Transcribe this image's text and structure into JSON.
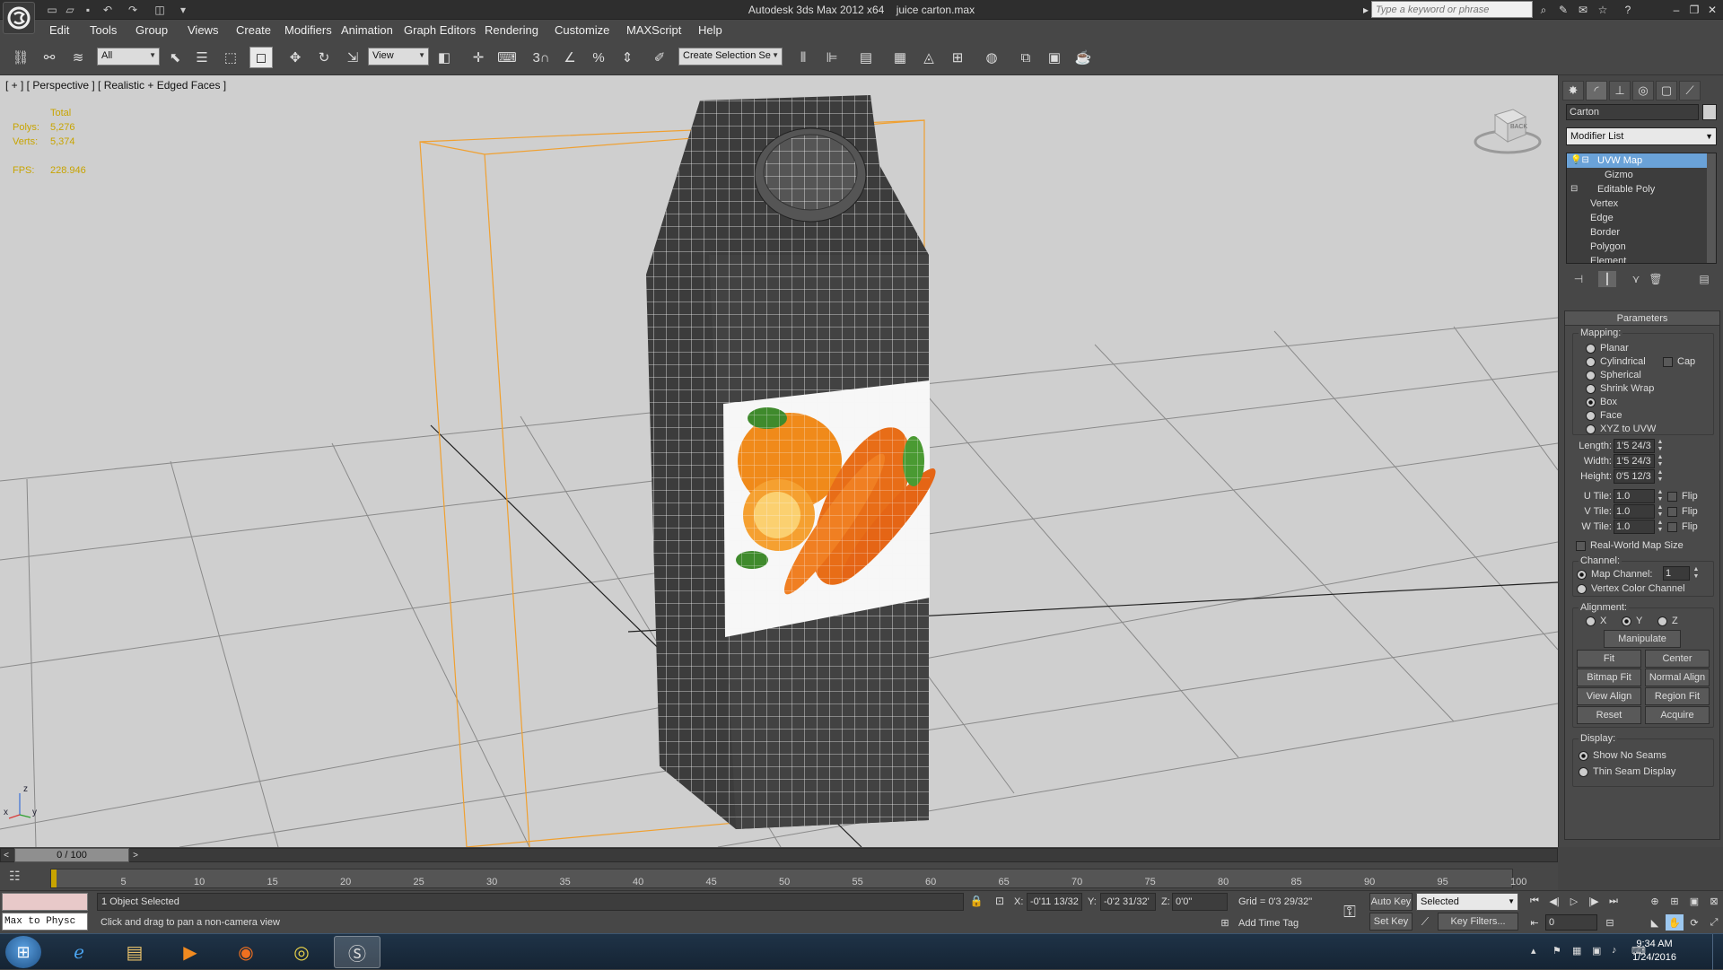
{
  "titlebar": {
    "app_title": "Autodesk 3ds Max  2012 x64",
    "file_name": "juice carton.max",
    "search_placeholder": "Type a keyword or phrase"
  },
  "menu": [
    "Edit",
    "Tools",
    "Group",
    "Views",
    "Create",
    "Modifiers",
    "Animation",
    "Graph Editors",
    "Rendering",
    "Customize",
    "MAXScript",
    "Help"
  ],
  "toolbar": {
    "selection_filter": "All",
    "ref_coord": "View",
    "named_selection": "Create Selection Se",
    "snap_label": "3"
  },
  "viewport": {
    "label": "[ + ] [ Perspective ] [ Realistic + Edged Faces ]",
    "stats": {
      "total_label": "Total",
      "polys_label": "Polys:",
      "polys_value": "5,276",
      "verts_label": "Verts:",
      "verts_value": "5,374",
      "fps_label": "FPS:",
      "fps_value": "228.946"
    },
    "viewcube_label": "BACK",
    "axis_z": "z",
    "axis_x": "x",
    "axis_y": "y"
  },
  "command_panel": {
    "object_name": "Carton",
    "modifier_list": "Modifier List",
    "stack": [
      {
        "label": "UVW Map",
        "indent": 0,
        "selected": true
      },
      {
        "label": "Gizmo",
        "indent": 2,
        "selected": false
      },
      {
        "label": "Editable Poly",
        "indent": 0,
        "selected": false
      },
      {
        "label": "Vertex",
        "indent": 1,
        "selected": false
      },
      {
        "label": "Edge",
        "indent": 1,
        "selected": false
      },
      {
        "label": "Border",
        "indent": 1,
        "selected": false
      },
      {
        "label": "Polygon",
        "indent": 1,
        "selected": false
      },
      {
        "label": "Element",
        "indent": 1,
        "selected": false
      }
    ],
    "parameters_title": "Parameters",
    "mapping_title": "Mapping:",
    "mapping_options": [
      "Planar",
      "Cylindrical",
      "Spherical",
      "Shrink Wrap",
      "Box",
      "Face",
      "XYZ to UVW"
    ],
    "mapping_selected": "Box",
    "cap_label": "Cap",
    "length_label": "Length:",
    "length_value": "1'5 24/3",
    "width_label": "Width:",
    "width_value": "1'5 24/3",
    "height_label": "Height:",
    "height_value": "0'5 12/3",
    "utile_label": "U Tile:",
    "utile_value": "1.0",
    "vtile_label": "V Tile:",
    "vtile_value": "1.0",
    "wtile_label": "W Tile:",
    "wtile_value": "1.0",
    "flip_label": "Flip",
    "real_world_label": "Real-World Map Size",
    "channel_title": "Channel:",
    "map_channel_label": "Map Channel:",
    "map_channel_value": "1",
    "vertex_color_label": "Vertex Color Channel",
    "alignment_title": "Alignment:",
    "align_x": "X",
    "align_y": "Y",
    "align_z": "Z",
    "manipulate": "Manipulate",
    "fit": "Fit",
    "center": "Center",
    "bitmap_fit": "Bitmap Fit",
    "normal_align": "Normal Align",
    "view_align": "View Align",
    "region_fit": "Region Fit",
    "reset": "Reset",
    "acquire": "Acquire",
    "display_title": "Display:",
    "show_no_seams": "Show No Seams",
    "thin_seam": "Thin Seam Display"
  },
  "timeline": {
    "slider_label": "0 / 100",
    "ticks": [
      "5",
      "10",
      "15",
      "20",
      "25",
      "30",
      "35",
      "40",
      "45",
      "50",
      "55",
      "60",
      "65",
      "70",
      "75",
      "80",
      "85",
      "90",
      "95",
      "100"
    ]
  },
  "status": {
    "maxscript_input": "Max to Physc",
    "selection": "1 Object Selected",
    "prompt": "Click and drag to pan a non-camera view",
    "x_label": "X:",
    "x_value": "-0'11 13/32",
    "y_label": "Y:",
    "y_value": "-0'2 31/32'",
    "z_label": "Z:",
    "z_value": "0'0\"",
    "grid": "Grid = 0'3 29/32\"",
    "add_time_tag": "Add Time Tag",
    "auto_key": "Auto Key",
    "set_key": "Set Key",
    "key_mode": "Selected",
    "key_filters": "Key Filters...",
    "frame": "0"
  },
  "taskbar": {
    "time": "9:34 AM",
    "date": "1/24/2016"
  },
  "colors": {
    "selection_box": "#f0a030",
    "grid_line": "#8a8a8a",
    "viewport_bg": "#cfcfcf",
    "stack_selected": "#6aa2d8"
  }
}
